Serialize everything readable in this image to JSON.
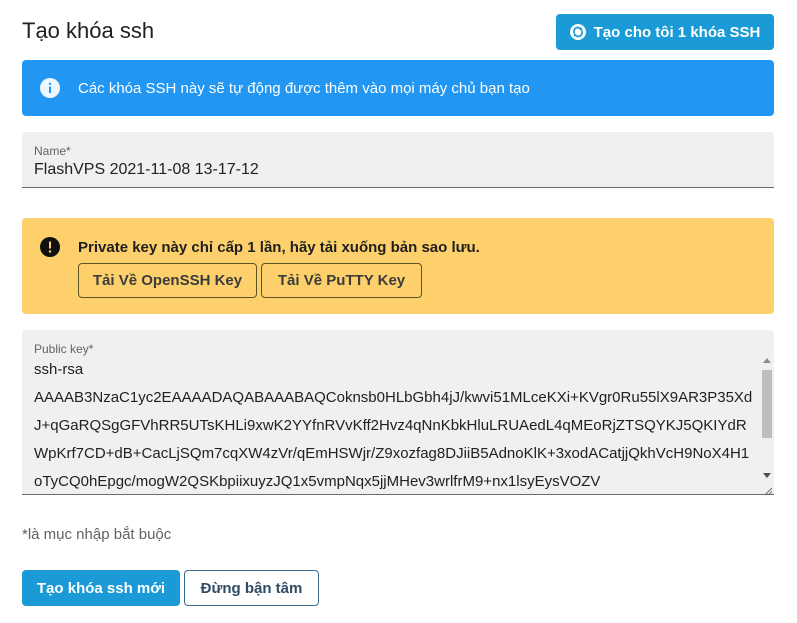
{
  "header": {
    "title": "Tạo khóa ssh",
    "generate_button": "Tạo cho tôi 1 khóa SSH",
    "generate_icon": "sync-icon"
  },
  "info_alert": {
    "icon": "info-icon",
    "text": "Các khóa SSH này sẽ tự động được thêm vào mọi máy chủ bạn tạo",
    "color": "#2196f3"
  },
  "name_field": {
    "label": "Name*",
    "value": "FlashVPS 2021-11-08 13-17-12"
  },
  "warning_alert": {
    "icon": "exclamation-icon",
    "text": "Private key này chỉ cấp 1 lần, hãy tải xuống bản sao lưu.",
    "openssh_button": "Tải Về OpenSSH Key",
    "putty_button": "Tải Về PuTTY Key",
    "color": "#fdd06b"
  },
  "public_key_field": {
    "label": "Public key*",
    "value": "ssh-rsa\nAAAAB3NzaC1yc2EAAAADAQABAAABAQCoknsb0HLbGbh4jJ/kwvi51MLceKXi+KVgr0Ru55lX9AR3P35XdJ+qGaRQSgGFVhRR5UTsKHLi9xwK2YYfnRVvKff2Hvz4qNnKbkHluLRUAedL4qMEoRjZTSQYKJ5QKIYdRWpKrf7CD+dB+CacLjSQm7cqXW4zVr/qEmHSWjr/Z9xozfag8DJiiB5AdnoKlK+3xodACatjjQkhVcH9NoX4H1oTyCQ0hEpgc/mogW2QSKbpiixuyzJQ1x5vmpNqx5jjMHev3wrlfrM9+nx1lsyEysVOZV"
  },
  "required_note": "*là mục nhập bắt buộc",
  "actions": {
    "create_button": "Tạo khóa ssh mới",
    "cancel_button": "Đừng bận tâm",
    "primary_color": "#1a9ad6"
  }
}
